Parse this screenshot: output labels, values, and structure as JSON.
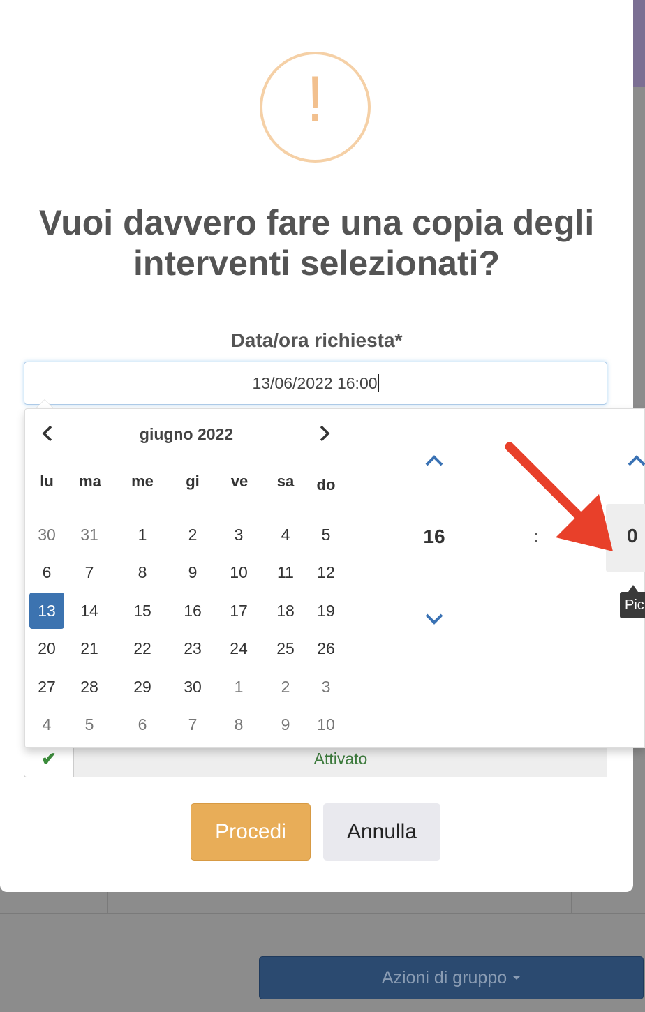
{
  "background": {
    "group_actions_label": "Azioni di gruppo"
  },
  "dialog": {
    "icon": "exclamation-icon",
    "title": "Vuoi davvero fare una copia degli interventi selezionati?",
    "date_label": "Data/ora richiesta*",
    "date_value": "13/06/2022 16:00",
    "switch_label": "Attivato",
    "proceed_label": "Procedi",
    "cancel_label": "Annulla"
  },
  "datepicker": {
    "month_title": "giugno 2022",
    "weekdays": [
      "lu",
      "ma",
      "me",
      "gi",
      "ve",
      "sa",
      "do"
    ],
    "weeks": [
      [
        "30",
        "31",
        "1",
        "2",
        "3",
        "4",
        "5"
      ],
      [
        "6",
        "7",
        "8",
        "9",
        "10",
        "11",
        "12"
      ],
      [
        "13",
        "14",
        "15",
        "16",
        "17",
        "18",
        "19"
      ],
      [
        "20",
        "21",
        "22",
        "23",
        "24",
        "25",
        "26"
      ],
      [
        "27",
        "28",
        "29",
        "30",
        "1",
        "2",
        "3"
      ],
      [
        "4",
        "5",
        "6",
        "7",
        "8",
        "9",
        "10"
      ]
    ],
    "selected_day": "13",
    "hour": "16",
    "time_separator": ":",
    "minute_partial": "0",
    "tooltip_partial": "Pic"
  },
  "colors": {
    "accent_blue": "#3c73b0",
    "proceed_orange": "#e8ad58",
    "warning_ring": "#f5d0a6",
    "annotation_red": "#e8402a"
  }
}
